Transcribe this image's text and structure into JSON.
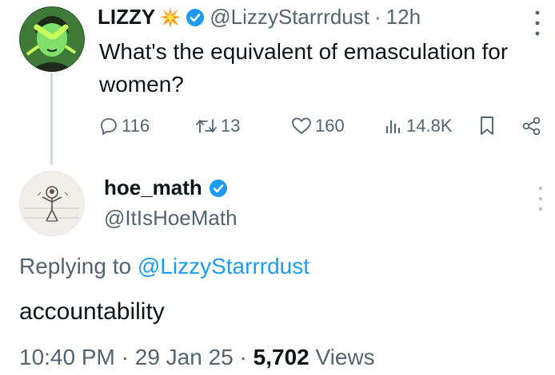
{
  "original_tweet": {
    "display_name": "LIZZY",
    "name_emoji": "spark-burst-emoji",
    "verified": true,
    "handle": "@LizzyStarrrdust",
    "separator": "·",
    "time_ago": "12h",
    "text": "What's the equivalent of emasculation for women?",
    "more_icon": "more-vertical-icon",
    "actions": {
      "replies": "116",
      "reposts": "13",
      "likes": "160",
      "views": "14.8K"
    }
  },
  "reply_tweet": {
    "display_name": "hoe_math",
    "verified": true,
    "handle": "@ItIsHoeMath",
    "more_icon": "more-vertical-icon",
    "replying_to_prefix": "Replying to",
    "replying_to_handle": "@LizzyStarrrdust",
    "text": "accountability",
    "timestamp_time": "10:40 PM",
    "separator": "·",
    "timestamp_date": "29 Jan 25",
    "views_count": "5,702",
    "views_label": "Views"
  },
  "colors": {
    "verified_blue": "#1d9bf0",
    "secondary_text": "#536471",
    "primary_text": "#0f1419",
    "thread_line": "#cfd9de"
  }
}
